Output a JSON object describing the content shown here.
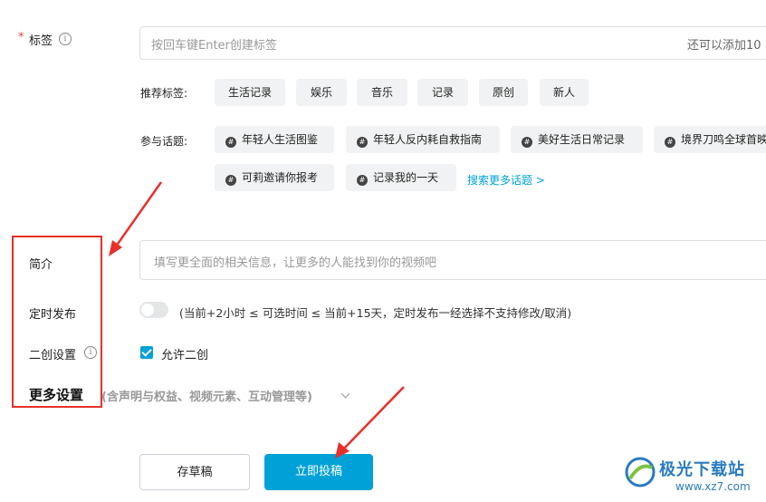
{
  "tags": {
    "required_mark": "*",
    "label": "标签",
    "info_glyph": "i",
    "placeholder": "按回车键Enter创建标签",
    "remaining": "还可以添加10"
  },
  "recommended": {
    "label": "推荐标签:",
    "items": [
      "生活记录",
      "娱乐",
      "音乐",
      "记录",
      "原创",
      "新人"
    ]
  },
  "topics": {
    "label": "参与话题:",
    "items": [
      "年轻人生活图鉴",
      "年轻人反内耗自救指南",
      "美好生活日常记录",
      "境界刀鸣全球首映",
      "可莉邀请你报考",
      "记录我的一天"
    ],
    "search_more": "搜索更多话题 >"
  },
  "intro": {
    "label": "简介",
    "placeholder": "填写更全面的相关信息，让更多的人能找到你的视频吧"
  },
  "schedule": {
    "label": "定时发布",
    "enabled": false,
    "hint": "(当前+2小时 ≤ 可选时间 ≤ 当前+15天，定时发布一经选择不支持修改/取消)"
  },
  "derivative": {
    "label": "二创设置",
    "info_glyph": "i",
    "checked": true,
    "option": "允许二创"
  },
  "more_settings": {
    "title": "更多设置",
    "subtitle": "(含声明与权益、视频元素、互动管理等)"
  },
  "actions": {
    "draft": "存草稿",
    "submit": "立即投稿"
  },
  "watermark": {
    "name": "极光下载站",
    "url": "www.xz7.com"
  },
  "colors": {
    "accent": "#00a1d6",
    "annotation": "#e8302a"
  }
}
